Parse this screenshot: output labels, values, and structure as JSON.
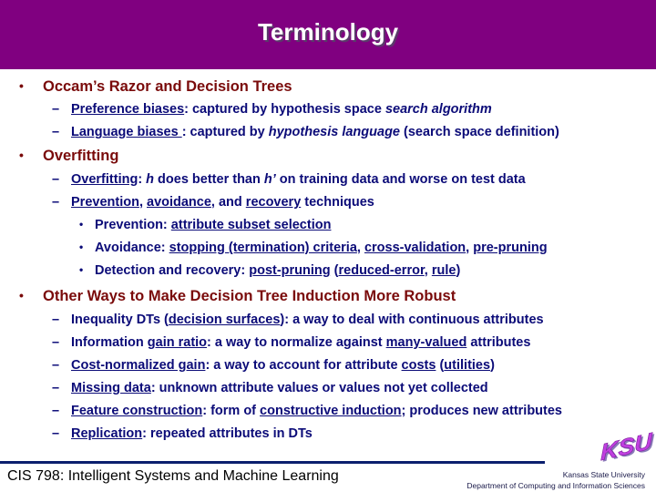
{
  "slide": {
    "title": "Terminology",
    "colors": {
      "title_bg": "#800080",
      "heading": "#7a0a0a",
      "body": "#0b0b78",
      "footer_rule": "#0b1f6e",
      "logo": "#b030d0"
    }
  },
  "sections": [
    {
      "heading": "Occam’s Razor and Decision Trees",
      "items": [
        {
          "term": "Preference biases",
          "rest_a": ": captured by hypothesis space ",
          "rest_italic": "search algorithm",
          "rest_b": ""
        },
        {
          "term": "Language biases ",
          "rest_a": ": captured by ",
          "rest_italic": "hypothesis language",
          "rest_b": " (search space definition)"
        }
      ]
    },
    {
      "heading": "Overfitting",
      "items": [
        {
          "term": "Overfitting",
          "p1": ": ",
          "h1": "h",
          "p2": " does better than ",
          "h2": "h’",
          "p3": " on training data and worse on test data"
        },
        {
          "t1": "Prevention",
          "s1": ", ",
          "t2": "avoidance",
          "s2": ", and ",
          "t3": "recovery",
          "s3": " techniques"
        }
      ],
      "subitems": [
        {
          "label": "Prevention: ",
          "u1": "attribute subset selection"
        },
        {
          "label": "Avoidance: ",
          "u1": "stopping (termination) criteria",
          "s1": ", ",
          "u2": "cross-validation",
          "s2": ", ",
          "u3": "pre-pruning"
        },
        {
          "label": "Detection and recovery: ",
          "u1": "post-pruning",
          "s1": " (",
          "u2": "reduced-error",
          "s2": ", ",
          "u3": "rule",
          "s3": ")"
        }
      ]
    },
    {
      "heading": "Other Ways to Make Decision Tree Induction More Robust",
      "items": [
        {
          "pre": "Inequality DTs (",
          "u1": "decision surfaces",
          "mid": "): a way to deal with continuous attributes"
        },
        {
          "pre": "Information ",
          "u1": "gain ratio",
          "mid": ": a way to normalize against ",
          "u2": "many-valued",
          "post": " attributes"
        },
        {
          "u1": "Cost-normalized gain",
          "mid": ": a way to account for attribute ",
          "u2": "costs",
          "mid2": " (",
          "u3": "utilities",
          "post": ")"
        },
        {
          "u1": "Missing data",
          "mid": ": unknown attribute values or values not yet collected"
        },
        {
          "u1": "Feature construction",
          "mid": ": form of ",
          "u2": "constructive induction",
          "post": "; produces new attributes"
        },
        {
          "u1": "Replication",
          "mid": ": repeated attributes in DTs"
        }
      ]
    }
  ],
  "glyphs": {
    "bullet": "•",
    "dash": "–",
    "sub_bullet": "•"
  },
  "footer": {
    "course": "CIS 798: Intelligent Systems and Machine Learning",
    "logo_text": "KSU",
    "university": "Kansas State University",
    "department": "Department of Computing and Information Sciences"
  }
}
